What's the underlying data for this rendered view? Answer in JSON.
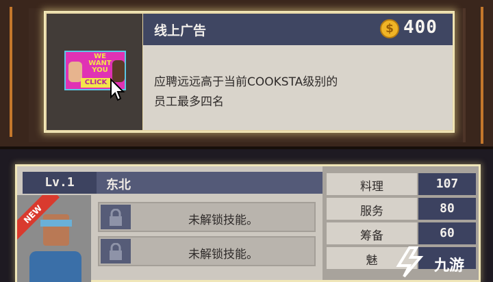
{
  "ad": {
    "title": "线上广告",
    "price": "400",
    "coin_symbol": "$",
    "description_line1": "应聘远远高于当前COOKSTA级别的",
    "description_line2": "员工最多四名",
    "thumbnail": {
      "text": "WE WANT YOU",
      "button": "CLICK"
    }
  },
  "employee": {
    "level": "Lv.1",
    "name": "东北",
    "badge": "NEW",
    "skills": [
      {
        "label": "未解锁技能。",
        "icon": "lock-icon"
      },
      {
        "label": "未解锁技能。",
        "icon": "lock-icon"
      }
    ],
    "stats": [
      {
        "label": "料理",
        "value": "107"
      },
      {
        "label": "服务",
        "value": "80"
      },
      {
        "label": "筹备",
        "value": "60"
      },
      {
        "label": "魅",
        "value": ""
      }
    ]
  },
  "watermark": {
    "text": "九游"
  },
  "colors": {
    "header": "#3f4662",
    "card": "#d9d4cb",
    "coin": "#f0b426",
    "ribbon": "#d93a2e"
  }
}
